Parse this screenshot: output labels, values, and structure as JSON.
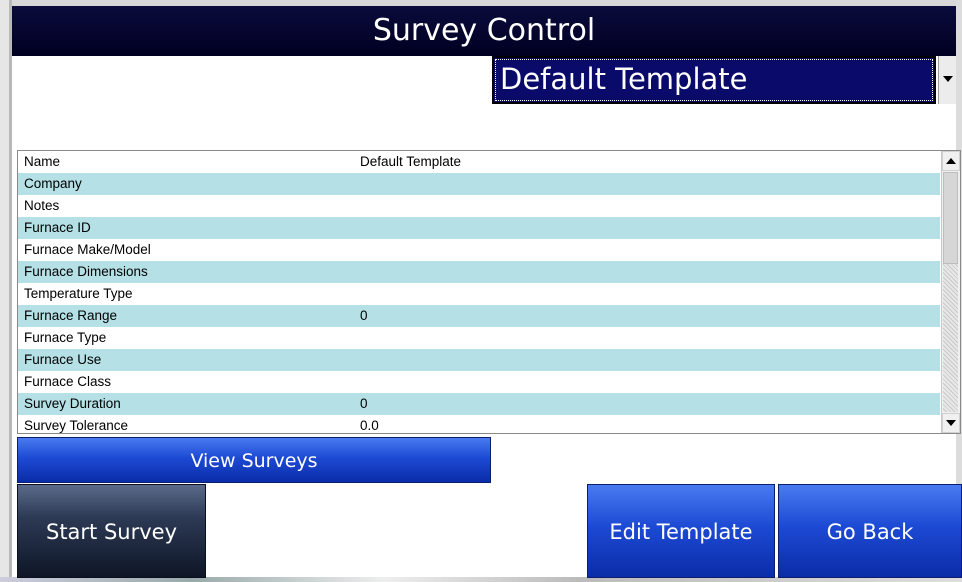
{
  "window": {
    "title": "Survey Control"
  },
  "template_select": {
    "value": "Default Template"
  },
  "grid": {
    "rows": [
      {
        "label": "Name",
        "value": "Default Template"
      },
      {
        "label": "Company",
        "value": ""
      },
      {
        "label": "Notes",
        "value": ""
      },
      {
        "label": "Furnace ID",
        "value": ""
      },
      {
        "label": "Furnace Make/Model",
        "value": ""
      },
      {
        "label": "Furnace Dimensions",
        "value": ""
      },
      {
        "label": "Temperature Type",
        "value": ""
      },
      {
        "label": "Furnace Range",
        "value": "0"
      },
      {
        "label": "Furnace Type",
        "value": ""
      },
      {
        "label": "Furnace Use",
        "value": ""
      },
      {
        "label": "Furnace Class",
        "value": ""
      },
      {
        "label": "Survey Duration",
        "value": "0"
      },
      {
        "label": "Survey Tolerance",
        "value": "0.0"
      }
    ]
  },
  "buttons": {
    "view_surveys": "View Surveys",
    "start_survey": "Start Survey",
    "edit_template": "Edit Template",
    "go_back": "Go Back"
  },
  "colors": {
    "title_bg": "#000022",
    "select_bg": "#0a0a6a",
    "row_alt": "#b4e0e6",
    "button_blue": "#1d4ad4",
    "button_dark": "#2d3a55"
  }
}
